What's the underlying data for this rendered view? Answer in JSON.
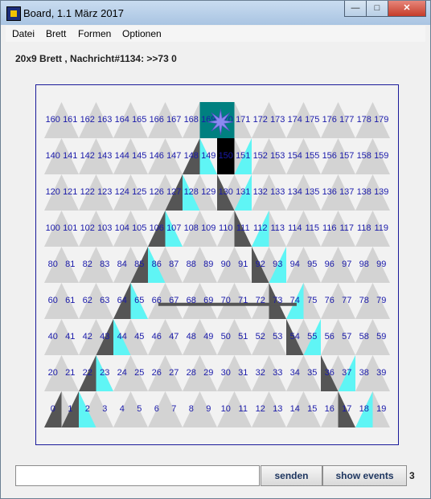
{
  "window": {
    "title": "Board, 1.1 März 2017",
    "minimize": "—",
    "maximize": "□",
    "close": "✕"
  },
  "menu": [
    "Datei",
    "Brett",
    "Formen",
    "Optionen"
  ],
  "info": "20x9 Brett , Nachricht#1134: >>73 0",
  "board": {
    "cols": 20,
    "rows": 9,
    "colors": {
      "cyan": "#5ff5f5",
      "dark": "#555555",
      "black": "#000000",
      "teal": "#008080",
      "gray": "#d3d3d3",
      "number": "#1a1aaa",
      "star": "#8a8af0"
    },
    "cells": [
      {
        "i": 0,
        "c": "dark",
        "t": "ur"
      },
      {
        "i": 1,
        "c": "dark",
        "t": "ur"
      },
      {
        "i": 2,
        "c": "cyan",
        "t": "ul"
      },
      {
        "i": 17,
        "c": "dark",
        "t": "ul"
      },
      {
        "i": 18,
        "c": "cyan",
        "t": "ur"
      },
      {
        "i": 22,
        "c": "dark",
        "t": "ur"
      },
      {
        "i": 23,
        "c": "cyan",
        "t": "ul"
      },
      {
        "i": 36,
        "c": "dark",
        "t": "ul"
      },
      {
        "i": 37,
        "c": "cyan",
        "t": "ur"
      },
      {
        "i": 43,
        "c": "dark",
        "t": "ur"
      },
      {
        "i": 44,
        "c": "cyan",
        "t": "ul"
      },
      {
        "i": 54,
        "c": "dark",
        "t": "ul"
      },
      {
        "i": 55,
        "c": "cyan",
        "t": "ur"
      },
      {
        "i": 64,
        "c": "dark",
        "t": "ur"
      },
      {
        "i": 65,
        "c": "cyan",
        "t": "ul"
      },
      {
        "i": 73,
        "c": "dark",
        "t": "ul"
      },
      {
        "i": 74,
        "c": "cyan",
        "t": "ur"
      },
      {
        "i": 85,
        "c": "dark",
        "t": "ur"
      },
      {
        "i": 86,
        "c": "cyan",
        "t": "ul"
      },
      {
        "i": 92,
        "c": "dark",
        "t": "ul"
      },
      {
        "i": 93,
        "c": "cyan",
        "t": "ur"
      },
      {
        "i": 106,
        "c": "dark",
        "t": "ur"
      },
      {
        "i": 107,
        "c": "cyan",
        "t": "ul"
      },
      {
        "i": 111,
        "c": "dark",
        "t": "ul"
      },
      {
        "i": 112,
        "c": "cyan",
        "t": "ur"
      },
      {
        "i": 127,
        "c": "dark",
        "t": "ur"
      },
      {
        "i": 128,
        "c": "cyan",
        "t": "ul"
      },
      {
        "i": 130,
        "c": "dark",
        "t": "ul"
      },
      {
        "i": 131,
        "c": "cyan",
        "t": "ur"
      },
      {
        "i": 148,
        "c": "dark",
        "t": "ur"
      },
      {
        "i": 149,
        "c": "cyan",
        "t": "ul"
      },
      {
        "i": 150,
        "c": "black",
        "t": "full"
      },
      {
        "i": 151,
        "c": "cyan",
        "t": "ur"
      },
      {
        "i": 169,
        "c": "teal",
        "t": "full"
      },
      {
        "i": 170,
        "c": "teal",
        "t": "full"
      }
    ],
    "crossbar": [
      66,
      74
    ],
    "star_cell": 170
  },
  "bottom": {
    "input_value": "",
    "send": "senden",
    "events": "show events",
    "count": "3"
  }
}
